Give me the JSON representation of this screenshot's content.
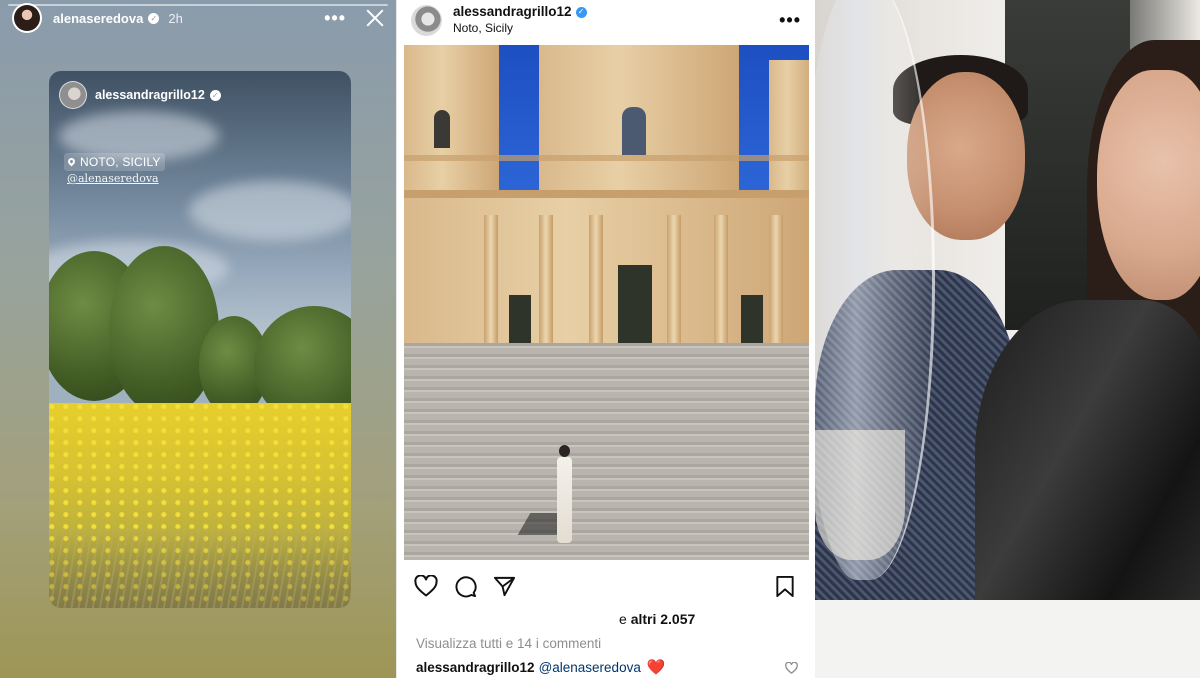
{
  "story": {
    "username": "alenaseredova",
    "time_ago": "2h",
    "more_glyph": "•••",
    "shared_post": {
      "username": "alessandragrillo12",
      "location_sticker": "NOTO, SICILY",
      "mention_sticker": "@alenaseredova"
    }
  },
  "post": {
    "username": "alessandragrillo12",
    "location": "Noto, Sicily",
    "more_glyph": "•••",
    "likes_text": "e ",
    "likes_bold": "altri 2.057",
    "comments_link": "Visualizza tutti e 14 i commenti",
    "caption": {
      "username": "alessandragrillo12",
      "mention": "@alenaseredova",
      "emoji": "❤️"
    }
  },
  "icons": {
    "verified": "✓"
  },
  "colors": {
    "link_blue": "#00376b",
    "verified_blue": "#3897f0",
    "heart_red": "#e0243a",
    "muted_gray": "#8e8e8e"
  }
}
